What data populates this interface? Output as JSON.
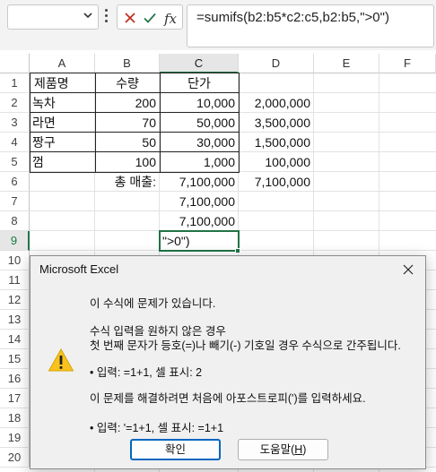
{
  "formula_bar": {
    "name_box_value": "",
    "formula": "=sumifs(b2:b5*c2:c5,b2:b5,\">0\")",
    "fx_label": "fx"
  },
  "columns": [
    "A",
    "B",
    "C",
    "D",
    "E",
    "F"
  ],
  "rows": [
    "1",
    "2",
    "3",
    "4",
    "5",
    "6",
    "7",
    "8",
    "9",
    "10",
    "11",
    "12",
    "13",
    "14",
    "15",
    "16",
    "17",
    "18",
    "19",
    "20"
  ],
  "selected": {
    "column": "C",
    "row": "9"
  },
  "cells": {
    "A1": "제품명",
    "B1": "수량",
    "C1": "단가",
    "A2": "녹차",
    "B2": "200",
    "C2": "10,000",
    "D2": "2,000,000",
    "A3": "라면",
    "B3": "70",
    "C3": "50,000",
    "D3": "3,500,000",
    "A4": "짱구",
    "B4": "50",
    "C4": "30,000",
    "D4": "1,500,000",
    "A5": "껌",
    "B5": "100",
    "C5": "1,000",
    "D5": "100,000",
    "B6": "총 매출:",
    "C6": "7,100,000",
    "D6": "7,100,000",
    "C7": "7,100,000",
    "C8": "7,100,000",
    "C9": "\">0\")"
  },
  "dialog": {
    "title": "Microsoft Excel",
    "icon": "warning-icon",
    "lines": [
      "이 수식에 문제가 있습니다.",
      "수식 입력을 원하지 않은 경우",
      "첫 번째 문자가 등호(=)나 빼기(-) 기호일 경우 수식으로 간주됩니다.",
      "• 입력:   =1+1, 셀 표시:   2",
      "이 문제를 해결하려면 처음에 아포스트로피(')를 입력하세요.",
      "• 입력:   '=1+1, 셀 표시:   =1+1"
    ],
    "ok_label": "확인",
    "help_label_prefix": "도움말(",
    "help_label_key": "H",
    "help_label_suffix": ")"
  },
  "colors": {
    "selection": "#217346",
    "primary_button_border": "#0067c0",
    "cancel_icon": "#c42b1c",
    "enter_icon": "#217346"
  }
}
